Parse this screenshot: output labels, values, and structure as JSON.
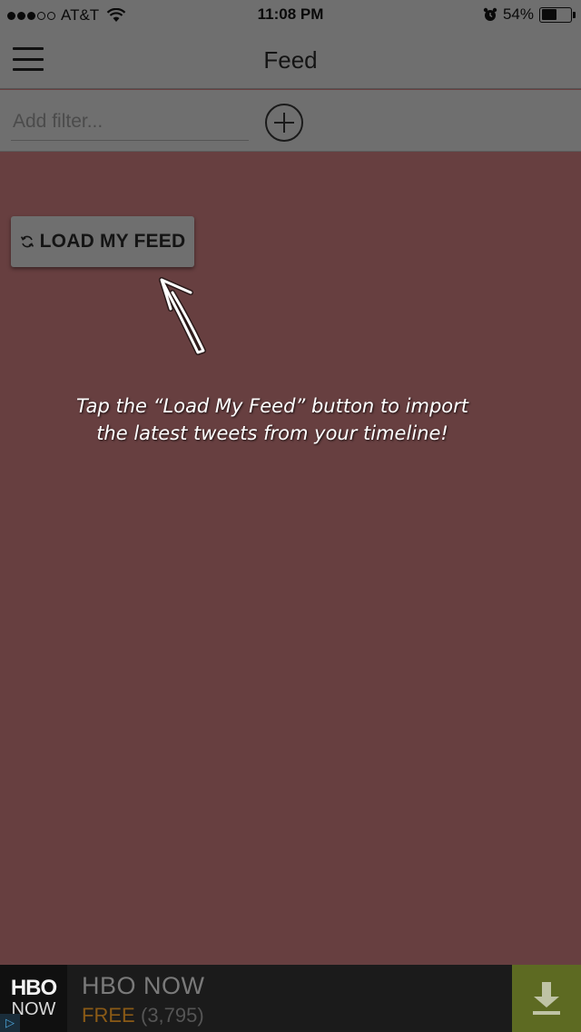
{
  "status_bar": {
    "carrier": "AT&T",
    "time": "11:08 PM",
    "battery_percent": "54%",
    "signal_bars": 3,
    "battery_level": 0.54,
    "icons": [
      "signal-icon",
      "wifi-icon",
      "alarm-icon",
      "battery-icon"
    ]
  },
  "nav": {
    "title": "Feed",
    "menu_icon": "hamburger-menu-icon"
  },
  "filter": {
    "placeholder": "Add filter...",
    "value": "",
    "add_icon": "plus-circle-icon"
  },
  "load_button": {
    "label": "LOAD MY FEED",
    "icon": "refresh-icon"
  },
  "overlay": {
    "line1": "Tap the “Load My Feed” button to import",
    "line2": "the latest tweets from your timeline!",
    "arrow_icon": "hand-drawn-arrow-icon"
  },
  "ad": {
    "logo_top": "HBO",
    "logo_bottom": "NOW",
    "title": "HBO NOW",
    "price": "FREE",
    "rating_count": "(3,795)",
    "choice_icon": "ad-choices-icon",
    "download_icon": "download-icon"
  },
  "colors": {
    "background": "#673f40",
    "header": "#6f6f6f",
    "ad_background": "#1b1b1b",
    "ad_download": "#5d6a22",
    "ad_price": "#8a5a16"
  }
}
